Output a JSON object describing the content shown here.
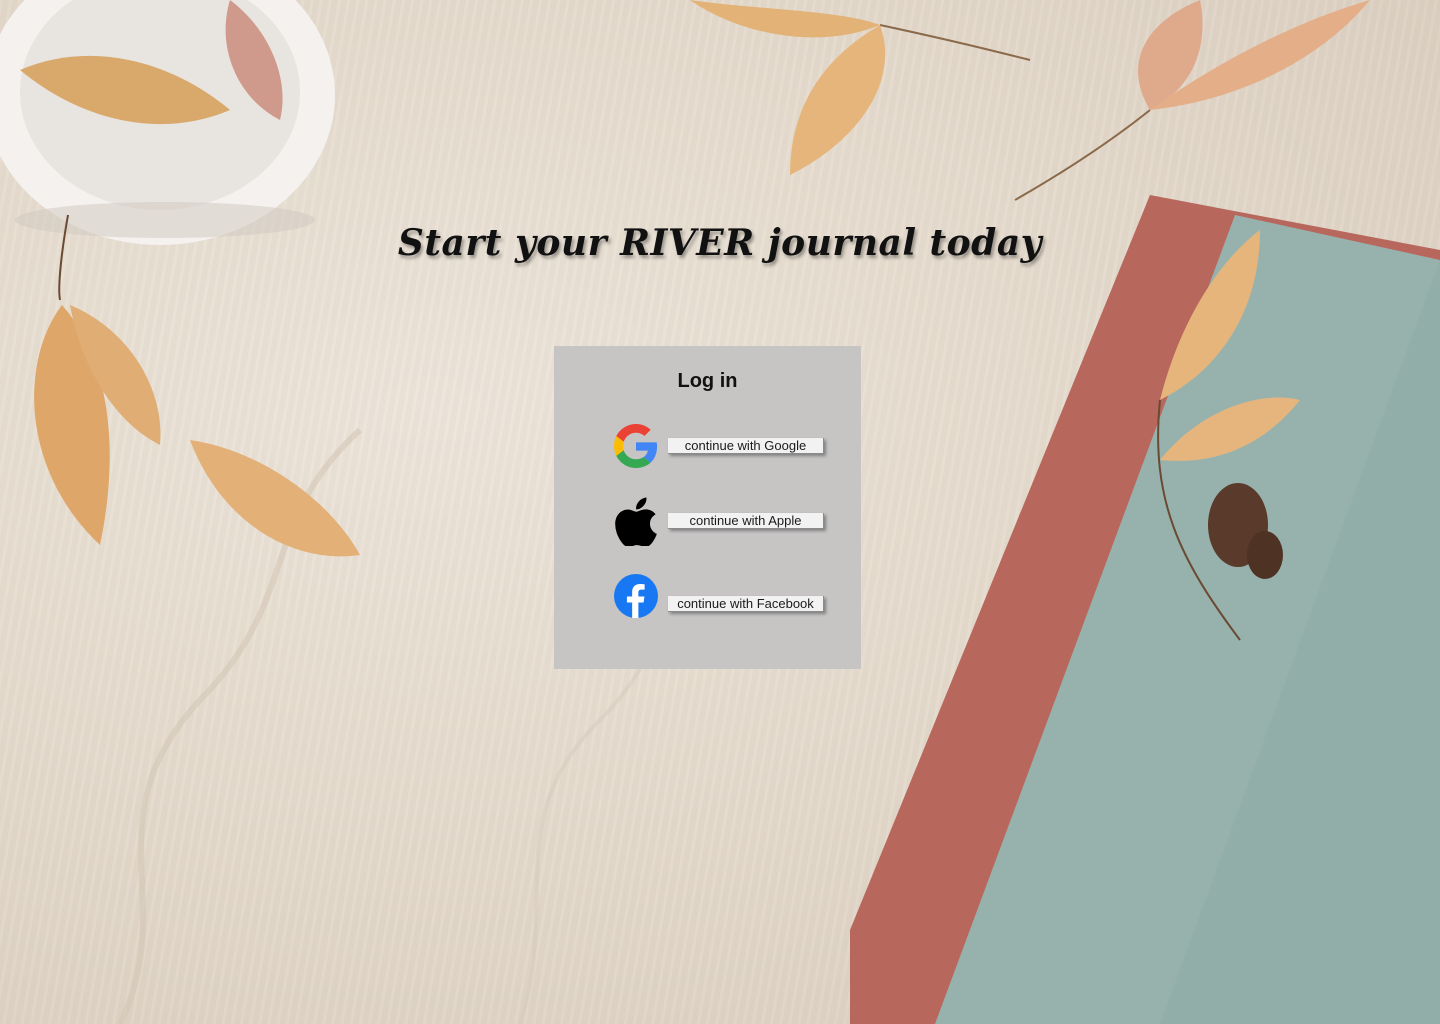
{
  "headline": "Start your RIVER journal today",
  "login": {
    "title": "Log in",
    "providers": [
      {
        "icon": "google-icon",
        "label": "continue with Google"
      },
      {
        "icon": "apple-icon",
        "label": "continue with Apple"
      },
      {
        "icon": "facebook-icon",
        "label": "continue with Facebook"
      }
    ]
  },
  "colors": {
    "card_background": "#c6c5c4",
    "button_background": "#f2f2f2",
    "google_blue": "#4285F4",
    "google_red": "#EA4335",
    "google_yellow": "#FBBC05",
    "google_green": "#34A853",
    "facebook_blue": "#1877F2"
  }
}
